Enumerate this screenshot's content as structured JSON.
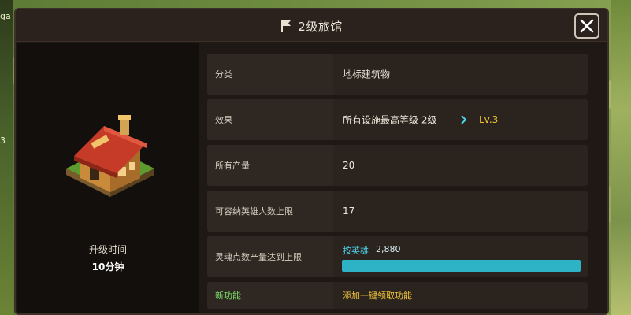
{
  "panel": {
    "title": "2级旅馆",
    "title_icon": "flag-icon",
    "close_icon": "close-icon"
  },
  "left": {
    "building_icon": "inn-building-icon",
    "upgrade_label": "升级时间",
    "upgrade_time": "10分钟"
  },
  "rows": [
    {
      "label": "分类",
      "value": "地标建筑物"
    },
    {
      "label": "效果",
      "value": "所有设施最高等级  2级",
      "next_level": "Lv.3"
    },
    {
      "label": "所有产量",
      "value": "20"
    },
    {
      "label": "可容纳英雄人数上限",
      "value": "17"
    },
    {
      "label": "灵魂点数产量达到上限",
      "hero_label": "按英雄",
      "hero_value": "2,880",
      "progress": 1.0
    },
    {
      "label": "新功能",
      "value": "添加一键领取功能"
    }
  ],
  "edge": {
    "left_texts": [
      "ga",
      "3"
    ]
  },
  "colors": {
    "accent_yellow": "#f0c43a",
    "accent_cyan": "#2eb2c6",
    "accent_green": "#7fe36a",
    "panel_bg": "#1f1915"
  }
}
